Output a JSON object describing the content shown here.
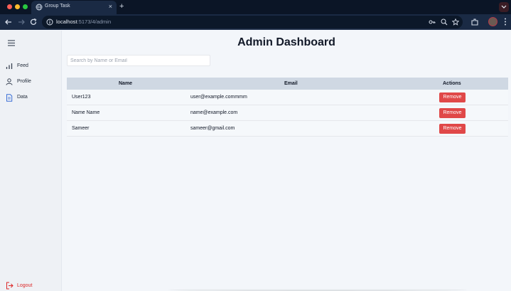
{
  "browser": {
    "tab_title": "Group Task",
    "tab_close": "×",
    "new_tab": "+",
    "url_host": "localhost",
    "url_path": ":5173/4/admin",
    "icons": [
      "back-arrow-icon",
      "forward-arrow-icon",
      "reload-icon",
      "site-info-icon",
      "password-key-icon",
      "zoom-icon",
      "bookmark-star-icon",
      "extensions-icon",
      "profile-avatar",
      "menu-kebab-icon"
    ]
  },
  "sidebar": {
    "items": [
      {
        "label": "Feed",
        "icon": "bar-chart-icon"
      },
      {
        "label": "Profile",
        "icon": "user-icon"
      },
      {
        "label": "Data",
        "icon": "document-icon"
      }
    ],
    "logout_label": "Logout"
  },
  "main": {
    "title": "Admin Dashboard",
    "search_placeholder": "Search by Name or Email",
    "table": {
      "columns": [
        "Name",
        "Email",
        "Actions"
      ],
      "rows": [
        {
          "name": "User123",
          "email": "user@example.commmm",
          "action": "Remove"
        },
        {
          "name": "Name Name",
          "email": "name@example.com",
          "action": "Remove"
        },
        {
          "name": "Sameer",
          "email": "sameer@gmail.com",
          "action": "Remove"
        }
      ]
    }
  },
  "colors": {
    "accent_red": "#e04848",
    "table_header": "#cfd8e3",
    "browser_dark": "#0b1526",
    "logout_red": "#dc2626"
  }
}
